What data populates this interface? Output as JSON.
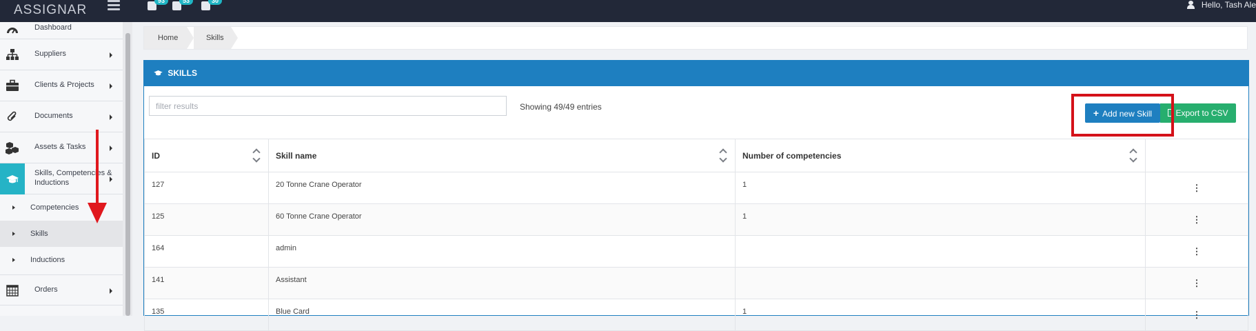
{
  "topbar": {
    "logo": "ASSIGNAR",
    "badges": [
      "93",
      "53",
      "30"
    ],
    "greeting": "Hello, Tash Ale"
  },
  "sidebar": {
    "items": [
      {
        "label": "Dashboard",
        "icon": "dashboard-icon"
      },
      {
        "label": "Suppliers",
        "icon": "sitemap-icon"
      },
      {
        "label": "Clients & Projects",
        "icon": "briefcase-icon"
      },
      {
        "label": "Documents",
        "icon": "paperclip-icon"
      },
      {
        "label": "Assets & Tasks",
        "icon": "cubes-icon"
      },
      {
        "label": "Skills, Competencies & Inductions",
        "icon": "graduation-cap-icon"
      },
      {
        "label": "Orders",
        "icon": "calendar-icon"
      }
    ],
    "subitems": [
      {
        "label": "Competencies"
      },
      {
        "label": "Skills"
      },
      {
        "label": "Inductions"
      }
    ]
  },
  "breadcrumb": [
    "Home",
    "Skills"
  ],
  "panel": {
    "title": "SKILLS",
    "filter_placeholder": "filter results",
    "showing": "Showing 49/49 entries",
    "add_label": "Add new Skill",
    "export_label": "Export to CSV"
  },
  "table": {
    "headers": [
      "ID",
      "Skill name",
      "Number of competencies",
      ""
    ],
    "rows": [
      {
        "id": "127",
        "name": "20 Tonne Crane Operator",
        "count": "1"
      },
      {
        "id": "125",
        "name": "60 Tonne Crane Operator",
        "count": "1"
      },
      {
        "id": "164",
        "name": "admin",
        "count": ""
      },
      {
        "id": "141",
        "name": "Assistant",
        "count": ""
      },
      {
        "id": "135",
        "name": "Blue Card",
        "count": "1"
      }
    ]
  },
  "colors": {
    "topbar": "#222838",
    "accent": "#1e7fc0",
    "active_nav": "#25b3c6",
    "export": "#27ae6e",
    "annotation": "#e0181e"
  }
}
